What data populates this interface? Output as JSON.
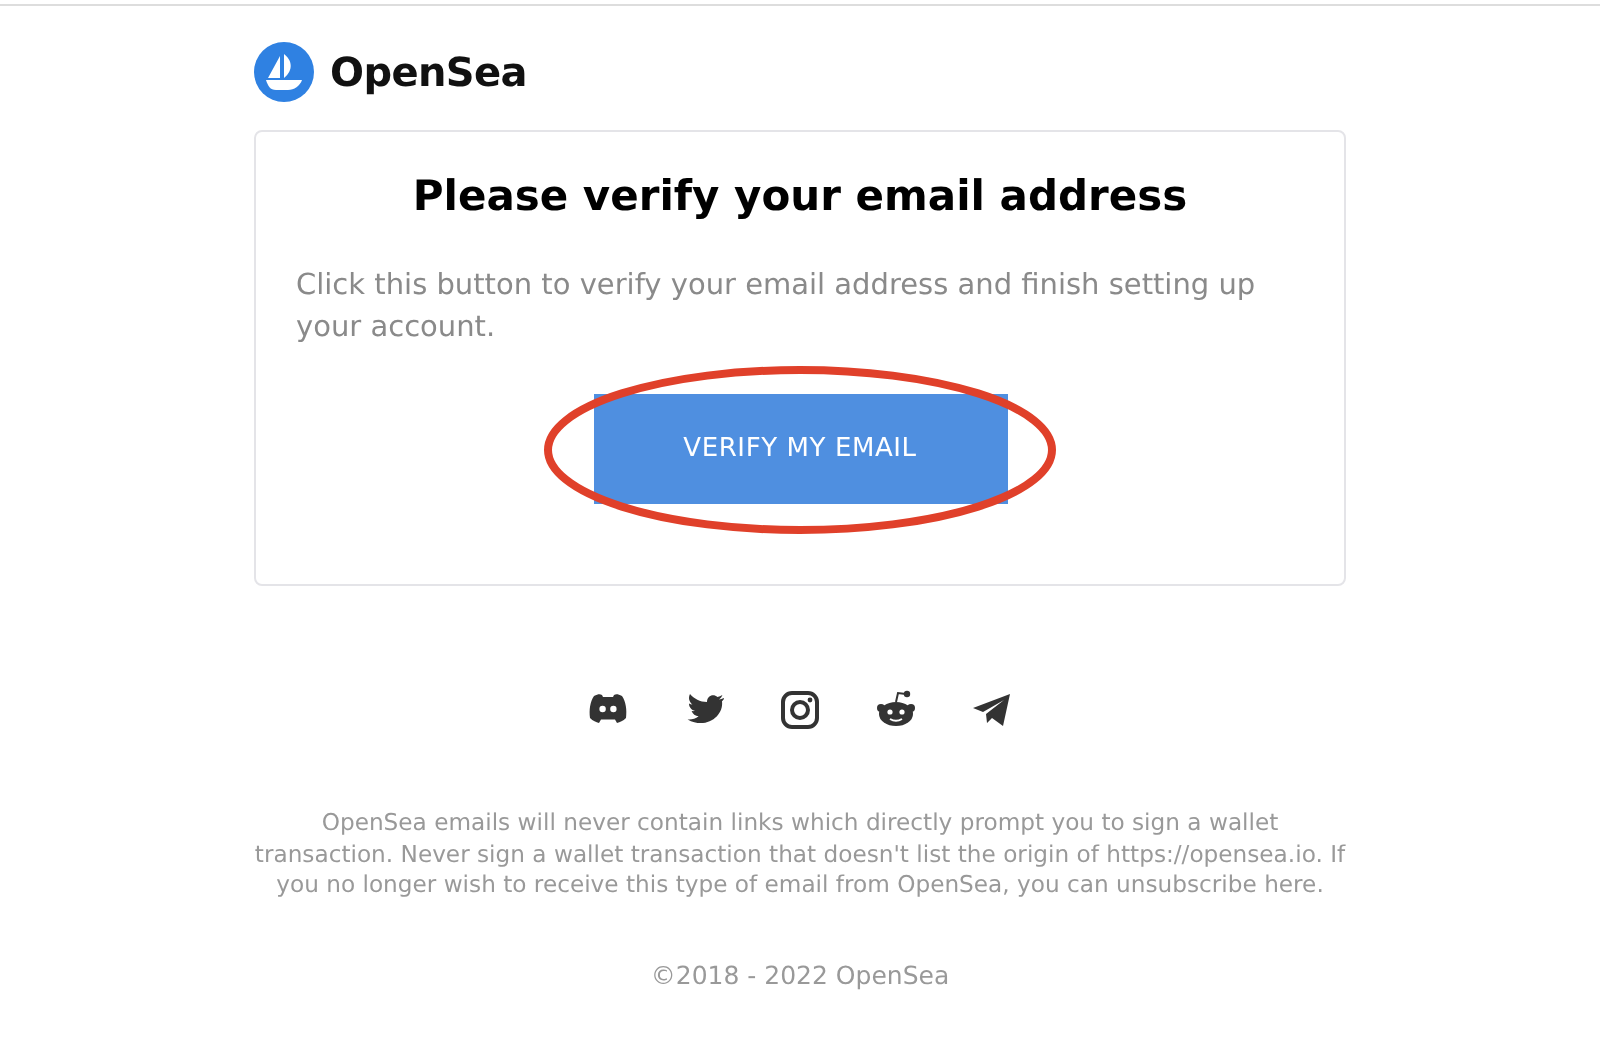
{
  "brand": {
    "name": "OpenSea"
  },
  "card": {
    "title": "Please verify your email address",
    "text": "Click this button to verify your email address and finish setting up your account.",
    "button": {
      "label": "VERIFY MY EMAIL",
      "highlighted": true
    }
  },
  "social_links": [
    {
      "kind": "discord"
    },
    {
      "kind": "twitter"
    },
    {
      "kind": "instagram"
    },
    {
      "kind": "reddit"
    },
    {
      "kind": "telegram"
    }
  ],
  "footer": {
    "notice": [
      {
        "kind": "text",
        "text": "OpenSea emails will never contain links which directly prompt you to sign a wallet transaction. Never sign a wallet transaction that doesn't list the origin of "
      },
      {
        "kind": "link",
        "text": "https://opensea.io"
      },
      {
        "kind": "text",
        "text": ". If you no longer wish to receive this type of email from OpenSea, you can unsubscribe "
      },
      {
        "kind": "link",
        "text": "here"
      },
      {
        "kind": "text",
        "text": "."
      }
    ],
    "copyright": "©2018 - 2022 OpenSea"
  }
}
